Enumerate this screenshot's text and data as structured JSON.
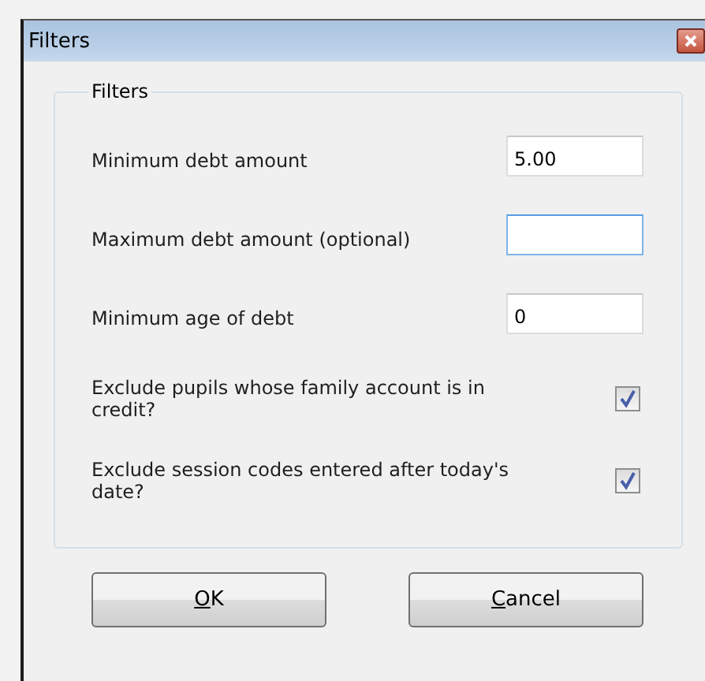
{
  "window": {
    "title": "Filters"
  },
  "group": {
    "title": "Filters"
  },
  "rows": [
    {
      "kind": "field",
      "label": "Minimum debt amount",
      "value": "5.00",
      "focused": false
    },
    {
      "kind": "field",
      "label": "Maximum debt amount (optional)",
      "value": "",
      "focused": true
    },
    {
      "kind": "field",
      "label": "Minimum age of debt",
      "value": "0",
      "focused": false
    },
    {
      "kind": "checkbox",
      "label": "Exclude pupils whose family account is in credit?",
      "checked": true
    },
    {
      "kind": "checkbox",
      "label": "Exclude session codes entered after today's date?",
      "checked": true
    }
  ],
  "buttons": [
    {
      "label": "OK",
      "underline_first": true
    },
    {
      "label": "Cancel",
      "underline_first": true
    }
  ]
}
